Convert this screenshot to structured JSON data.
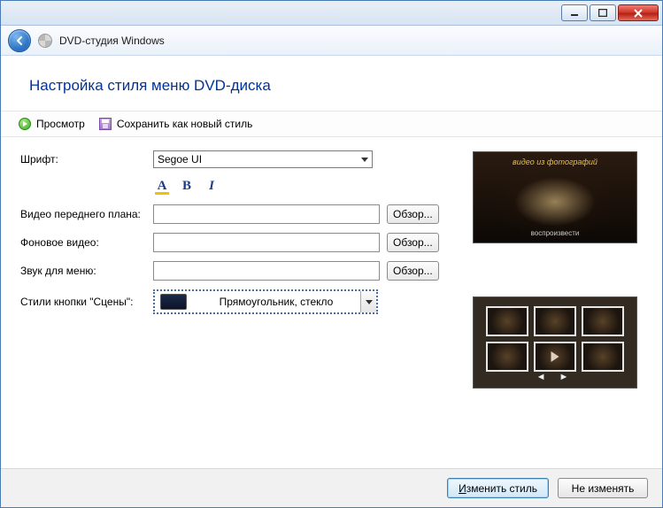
{
  "app_title": "DVD-студия Windows",
  "page_title": "Настройка стиля меню DVD-диска",
  "toolbar": {
    "preview": "Просмотр",
    "save_style": "Сохранить как новый стиль"
  },
  "labels": {
    "font": "Шрифт:",
    "fg_video": "Видео переднего плана:",
    "bg_video": "Фоновое видео:",
    "menu_audio": "Звук для меню:",
    "scene_button_styles": "Стили кнопки \"Сцены\":"
  },
  "fields": {
    "font_value": "Segoe UI",
    "fg_video_value": "",
    "bg_video_value": "",
    "menu_audio_value": "",
    "scene_style_value": "Прямоугольник, стекло"
  },
  "buttons": {
    "browse": "Обзор...",
    "apply": "Изменить стиль",
    "cancel": "Не изменять"
  },
  "font_style_glyphs": {
    "color": "A",
    "bold": "B",
    "italic": "I"
  },
  "preview1": {
    "title": "видео из фотографий",
    "sub": "воспроизвести"
  }
}
